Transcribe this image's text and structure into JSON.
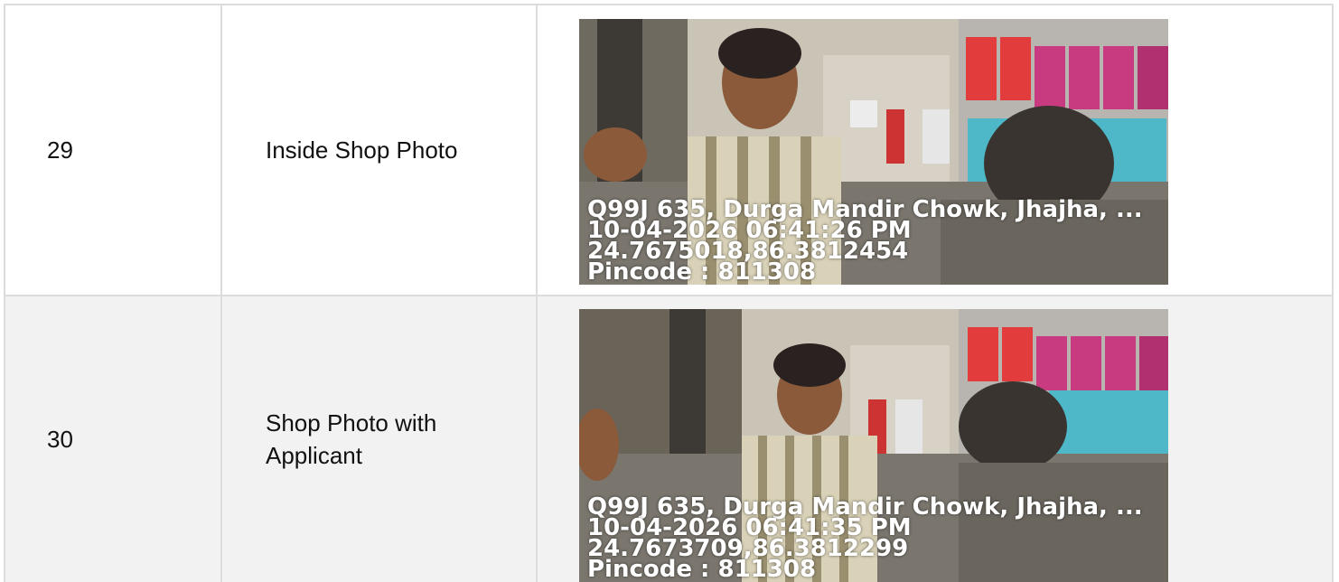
{
  "rows": [
    {
      "number": "29",
      "label": "Inside Shop Photo",
      "photo": {
        "address": "Q99J 635, Durga Mandir Chowk, Jhajha, ...",
        "datetime": "10-04-2026 06:41:26 PM",
        "coords": "24.7675018,86.3812454",
        "pincode": "Pincode : 811308"
      }
    },
    {
      "number": "30",
      "label": "Shop Photo with Applicant",
      "photo": {
        "address": "Q99J 635, Durga Mandir Chowk, Jhajha, ...",
        "datetime": "10-04-2026 06:41:35 PM",
        "coords": "24.7673709,86.3812299",
        "pincode": "Pincode : 811308"
      }
    }
  ],
  "colors": {
    "border": "#dcdcdc",
    "alt_row": "#f2f2f2"
  }
}
